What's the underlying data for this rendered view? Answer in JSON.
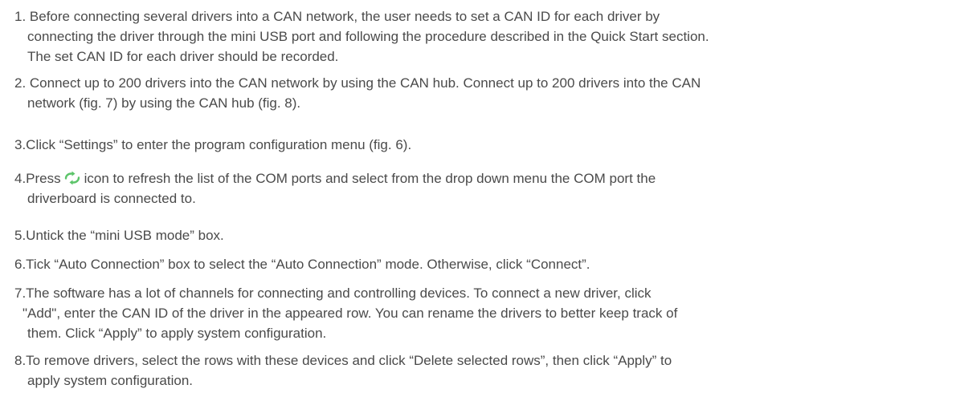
{
  "steps": [
    {
      "lines": [
        "1. Before connecting several drivers into a CAN network, the user needs to set a CAN ID for each driver by",
        "connecting the driver through the mini USB port and following the procedure described in the Quick Start section.",
        "The set CAN ID for each driver should be recorded."
      ]
    },
    {
      "lines": [
        "2. Connect up to 200 drivers into the CAN network by using the CAN hub.  Connect up to 200 drivers into the CAN",
        "network (fig. 7) by using the CAN hub (fig. 8)."
      ]
    },
    {
      "lines": [
        "3.Click “Settings” to enter the program configuration menu (fig. 6)."
      ]
    },
    {
      "before_icon": "4.Press",
      "after_icon": "icon to refresh the list of the COM ports and select from the drop down menu the COM port the",
      "lines": [
        "driverboard is connected to."
      ]
    },
    {
      "lines": [
        "5.Untick the “mini USB mode” box."
      ]
    },
    {
      "lines": [
        "6.Tick “Auto Connection” box to select the “Auto Connection” mode. Otherwise, click “Connect”."
      ]
    },
    {
      "lines": [
        "7.The software has a lot of channels for connecting and controlling devices. To connect a new driver, click",
        "\"Add\", enter the CAN ID of the driver in the appeared row. You can rename the drivers to better keep track of",
        "them. Click “Apply” to apply system configuration."
      ]
    },
    {
      "lines": [
        "8.To remove drivers, select the rows with these devices and click “Delete selected rows”, then click “Apply” to",
        "apply system configuration."
      ]
    }
  ],
  "icons": {
    "refresh": "refresh-icon",
    "refresh_color": "#5cc46a"
  }
}
